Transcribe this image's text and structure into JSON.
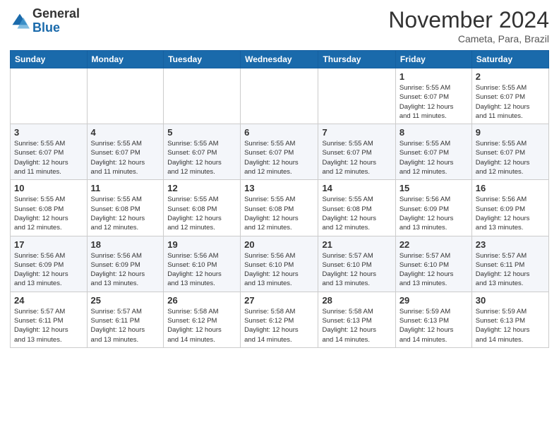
{
  "header": {
    "logo_general": "General",
    "logo_blue": "Blue",
    "month_title": "November 2024",
    "subtitle": "Cameta, Para, Brazil"
  },
  "days_of_week": [
    "Sunday",
    "Monday",
    "Tuesday",
    "Wednesday",
    "Thursday",
    "Friday",
    "Saturday"
  ],
  "weeks": [
    [
      {
        "day": "",
        "info": ""
      },
      {
        "day": "",
        "info": ""
      },
      {
        "day": "",
        "info": ""
      },
      {
        "day": "",
        "info": ""
      },
      {
        "day": "",
        "info": ""
      },
      {
        "day": "1",
        "info": "Sunrise: 5:55 AM\nSunset: 6:07 PM\nDaylight: 12 hours\nand 11 minutes."
      },
      {
        "day": "2",
        "info": "Sunrise: 5:55 AM\nSunset: 6:07 PM\nDaylight: 12 hours\nand 11 minutes."
      }
    ],
    [
      {
        "day": "3",
        "info": "Sunrise: 5:55 AM\nSunset: 6:07 PM\nDaylight: 12 hours\nand 11 minutes."
      },
      {
        "day": "4",
        "info": "Sunrise: 5:55 AM\nSunset: 6:07 PM\nDaylight: 12 hours\nand 11 minutes."
      },
      {
        "day": "5",
        "info": "Sunrise: 5:55 AM\nSunset: 6:07 PM\nDaylight: 12 hours\nand 12 minutes."
      },
      {
        "day": "6",
        "info": "Sunrise: 5:55 AM\nSunset: 6:07 PM\nDaylight: 12 hours\nand 12 minutes."
      },
      {
        "day": "7",
        "info": "Sunrise: 5:55 AM\nSunset: 6:07 PM\nDaylight: 12 hours\nand 12 minutes."
      },
      {
        "day": "8",
        "info": "Sunrise: 5:55 AM\nSunset: 6:07 PM\nDaylight: 12 hours\nand 12 minutes."
      },
      {
        "day": "9",
        "info": "Sunrise: 5:55 AM\nSunset: 6:07 PM\nDaylight: 12 hours\nand 12 minutes."
      }
    ],
    [
      {
        "day": "10",
        "info": "Sunrise: 5:55 AM\nSunset: 6:08 PM\nDaylight: 12 hours\nand 12 minutes."
      },
      {
        "day": "11",
        "info": "Sunrise: 5:55 AM\nSunset: 6:08 PM\nDaylight: 12 hours\nand 12 minutes."
      },
      {
        "day": "12",
        "info": "Sunrise: 5:55 AM\nSunset: 6:08 PM\nDaylight: 12 hours\nand 12 minutes."
      },
      {
        "day": "13",
        "info": "Sunrise: 5:55 AM\nSunset: 6:08 PM\nDaylight: 12 hours\nand 12 minutes."
      },
      {
        "day": "14",
        "info": "Sunrise: 5:55 AM\nSunset: 6:08 PM\nDaylight: 12 hours\nand 12 minutes."
      },
      {
        "day": "15",
        "info": "Sunrise: 5:56 AM\nSunset: 6:09 PM\nDaylight: 12 hours\nand 13 minutes."
      },
      {
        "day": "16",
        "info": "Sunrise: 5:56 AM\nSunset: 6:09 PM\nDaylight: 12 hours\nand 13 minutes."
      }
    ],
    [
      {
        "day": "17",
        "info": "Sunrise: 5:56 AM\nSunset: 6:09 PM\nDaylight: 12 hours\nand 13 minutes."
      },
      {
        "day": "18",
        "info": "Sunrise: 5:56 AM\nSunset: 6:09 PM\nDaylight: 12 hours\nand 13 minutes."
      },
      {
        "day": "19",
        "info": "Sunrise: 5:56 AM\nSunset: 6:10 PM\nDaylight: 12 hours\nand 13 minutes."
      },
      {
        "day": "20",
        "info": "Sunrise: 5:56 AM\nSunset: 6:10 PM\nDaylight: 12 hours\nand 13 minutes."
      },
      {
        "day": "21",
        "info": "Sunrise: 5:57 AM\nSunset: 6:10 PM\nDaylight: 12 hours\nand 13 minutes."
      },
      {
        "day": "22",
        "info": "Sunrise: 5:57 AM\nSunset: 6:10 PM\nDaylight: 12 hours\nand 13 minutes."
      },
      {
        "day": "23",
        "info": "Sunrise: 5:57 AM\nSunset: 6:11 PM\nDaylight: 12 hours\nand 13 minutes."
      }
    ],
    [
      {
        "day": "24",
        "info": "Sunrise: 5:57 AM\nSunset: 6:11 PM\nDaylight: 12 hours\nand 13 minutes."
      },
      {
        "day": "25",
        "info": "Sunrise: 5:57 AM\nSunset: 6:11 PM\nDaylight: 12 hours\nand 13 minutes."
      },
      {
        "day": "26",
        "info": "Sunrise: 5:58 AM\nSunset: 6:12 PM\nDaylight: 12 hours\nand 14 minutes."
      },
      {
        "day": "27",
        "info": "Sunrise: 5:58 AM\nSunset: 6:12 PM\nDaylight: 12 hours\nand 14 minutes."
      },
      {
        "day": "28",
        "info": "Sunrise: 5:58 AM\nSunset: 6:13 PM\nDaylight: 12 hours\nand 14 minutes."
      },
      {
        "day": "29",
        "info": "Sunrise: 5:59 AM\nSunset: 6:13 PM\nDaylight: 12 hours\nand 14 minutes."
      },
      {
        "day": "30",
        "info": "Sunrise: 5:59 AM\nSunset: 6:13 PM\nDaylight: 12 hours\nand 14 minutes."
      }
    ]
  ]
}
